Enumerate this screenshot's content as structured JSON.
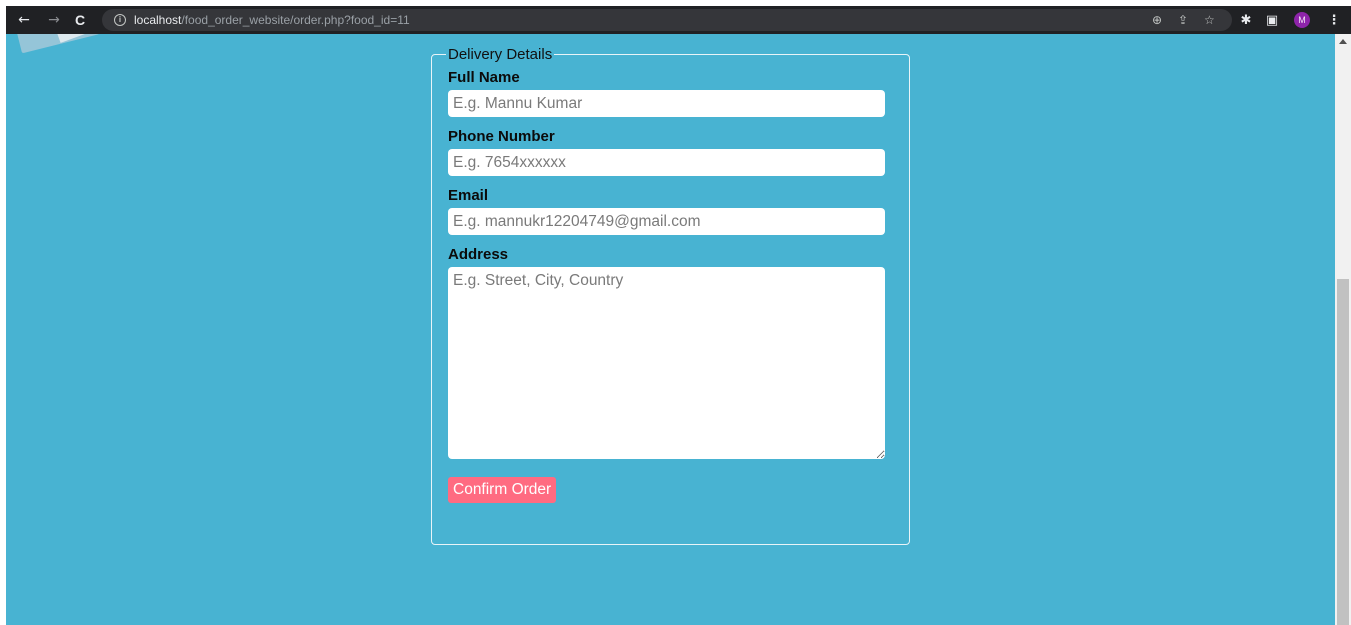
{
  "browser": {
    "back_icon": "←",
    "forward_icon": "→",
    "reload_icon": "C",
    "info_icon": "i",
    "url_host": "localhost",
    "url_path": "/food_order_website/order.php?food_id=11",
    "zoom_icon": "⊕",
    "share_icon": "⇪",
    "bookmark_icon": "☆",
    "extensions_icon": "✱",
    "sidepanel_icon": "▣",
    "profile_initial": "M",
    "menu_icon": "⋮"
  },
  "form": {
    "legend": "Delivery Details",
    "full_name": {
      "label": "Full Name",
      "placeholder": "E.g. Mannu Kumar"
    },
    "phone": {
      "label": "Phone Number",
      "placeholder": "E.g. 7654xxxxxx"
    },
    "email": {
      "label": "Email",
      "placeholder": "E.g. mannukr12204749@gmail.com"
    },
    "address": {
      "label": "Address",
      "placeholder": "E.g. Street, City, Country"
    },
    "submit_label": "Confirm Order"
  },
  "colors": {
    "page_background": "#48b3d2",
    "confirm_button": "#ff6b81",
    "toolbar": "#202124",
    "avatar": "#8e24aa"
  }
}
